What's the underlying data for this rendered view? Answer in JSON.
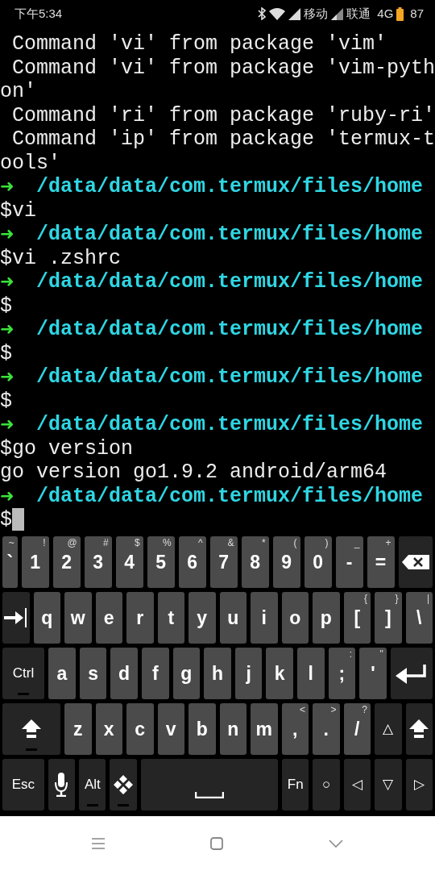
{
  "status_bar": {
    "time": "下午5:34",
    "carrier_1": "移动",
    "carrier_2": "联通",
    "network": "4G",
    "battery": "87"
  },
  "terminal": {
    "lines": [
      {
        "kind": "text",
        "text": " Command 'vi' from package 'vim'"
      },
      {
        "kind": "text",
        "text": " Command 'vi' from package 'vim-pyth"
      },
      {
        "kind": "text",
        "text": "on'"
      },
      {
        "kind": "text",
        "text": " Command 'ri' from package 'ruby-ri'"
      },
      {
        "kind": "text",
        "text": " Command 'ip' from package 'termux-t"
      },
      {
        "kind": "text",
        "text": "ools'"
      },
      {
        "kind": "prompt",
        "arrow": "➜",
        "path": "/data/data/com.termux/files/home"
      },
      {
        "kind": "text",
        "text": "$vi"
      },
      {
        "kind": "prompt",
        "arrow": "➜",
        "path": "/data/data/com.termux/files/home"
      },
      {
        "kind": "text",
        "text": "$vi .zshrc"
      },
      {
        "kind": "prompt",
        "arrow": "➜",
        "path": "/data/data/com.termux/files/home"
      },
      {
        "kind": "text",
        "text": "$"
      },
      {
        "kind": "prompt",
        "arrow": "➜",
        "path": "/data/data/com.termux/files/home"
      },
      {
        "kind": "text",
        "text": "$"
      },
      {
        "kind": "prompt",
        "arrow": "➜",
        "path": "/data/data/com.termux/files/home"
      },
      {
        "kind": "text",
        "text": "$"
      },
      {
        "kind": "prompt",
        "arrow": "➜",
        "path": "/data/data/com.termux/files/home"
      },
      {
        "kind": "text",
        "text": "$go version"
      },
      {
        "kind": "text",
        "text": "go version go1.9.2 android/arm64"
      },
      {
        "kind": "prompt",
        "arrow": "➜",
        "path": "/data/data/com.termux/files/home"
      },
      {
        "kind": "input",
        "text": "$"
      }
    ]
  },
  "keyboard": {
    "key_rows": [
      [
        {
          "kind": "char",
          "label": "`",
          "alt": "~"
        },
        {
          "kind": "char",
          "label": "1",
          "alt": "!"
        },
        {
          "kind": "char",
          "label": "2",
          "alt": "@"
        },
        {
          "kind": "char",
          "label": "3",
          "alt": "#"
        },
        {
          "kind": "char",
          "label": "4",
          "alt": "$"
        },
        {
          "kind": "char",
          "label": "5",
          "alt": "%"
        },
        {
          "kind": "char",
          "label": "6",
          "alt": "^"
        },
        {
          "kind": "char",
          "label": "7",
          "alt": "&"
        },
        {
          "kind": "char",
          "label": "8",
          "alt": "*"
        },
        {
          "kind": "char",
          "label": "9",
          "alt": "("
        },
        {
          "kind": "char",
          "label": "0",
          "alt": ")"
        },
        {
          "kind": "char",
          "label": "-",
          "alt": "_"
        },
        {
          "kind": "char",
          "label": "=",
          "alt": "+"
        },
        {
          "kind": "backspace"
        }
      ],
      [
        {
          "kind": "tab"
        },
        {
          "kind": "char",
          "label": "q"
        },
        {
          "kind": "char",
          "label": "w"
        },
        {
          "kind": "char",
          "label": "e"
        },
        {
          "kind": "char",
          "label": "r"
        },
        {
          "kind": "char",
          "label": "t"
        },
        {
          "kind": "char",
          "label": "y"
        },
        {
          "kind": "char",
          "label": "u"
        },
        {
          "kind": "char",
          "label": "i"
        },
        {
          "kind": "char",
          "label": "o"
        },
        {
          "kind": "char",
          "label": "p"
        },
        {
          "kind": "char",
          "label": "[",
          "alt": "{"
        },
        {
          "kind": "char",
          "label": "]",
          "alt": "}"
        },
        {
          "kind": "char",
          "label": "\\",
          "alt": "|"
        }
      ],
      [
        {
          "kind": "fn",
          "label": "Ctrl",
          "mod": true
        },
        {
          "kind": "char",
          "label": "a"
        },
        {
          "kind": "char",
          "label": "s"
        },
        {
          "kind": "char",
          "label": "d"
        },
        {
          "kind": "char",
          "label": "f"
        },
        {
          "kind": "char",
          "label": "g"
        },
        {
          "kind": "char",
          "label": "h"
        },
        {
          "kind": "char",
          "label": "j"
        },
        {
          "kind": "char",
          "label": "k"
        },
        {
          "kind": "char",
          "label": "l"
        },
        {
          "kind": "char",
          "label": ";",
          "alt": ":"
        },
        {
          "kind": "char",
          "label": "'",
          "alt": "\""
        },
        {
          "kind": "enter"
        }
      ],
      [
        {
          "kind": "shift",
          "mod": true
        },
        {
          "kind": "char",
          "label": "z"
        },
        {
          "kind": "char",
          "label": "x"
        },
        {
          "kind": "char",
          "label": "c"
        },
        {
          "kind": "char",
          "label": "v"
        },
        {
          "kind": "char",
          "label": "b"
        },
        {
          "kind": "char",
          "label": "n"
        },
        {
          "kind": "char",
          "label": "m"
        },
        {
          "kind": "char",
          "label": ",",
          "alt": "<"
        },
        {
          "kind": "char",
          "label": ".",
          "alt": ">"
        },
        {
          "kind": "char",
          "label": "/",
          "alt": "?"
        },
        {
          "kind": "fn",
          "label": "△"
        },
        {
          "kind": "shift"
        }
      ],
      [
        {
          "kind": "fn",
          "label": "Esc"
        },
        {
          "kind": "mic"
        },
        {
          "kind": "fn",
          "label": "Alt",
          "mod": true
        },
        {
          "kind": "meta",
          "mod": true
        },
        {
          "kind": "space"
        },
        {
          "kind": "fn",
          "label": "Fn"
        },
        {
          "kind": "fn",
          "label": "○"
        },
        {
          "kind": "fn",
          "label": "◁"
        },
        {
          "kind": "fn",
          "label": "▽"
        },
        {
          "kind": "fn",
          "label": "▷"
        }
      ]
    ]
  }
}
